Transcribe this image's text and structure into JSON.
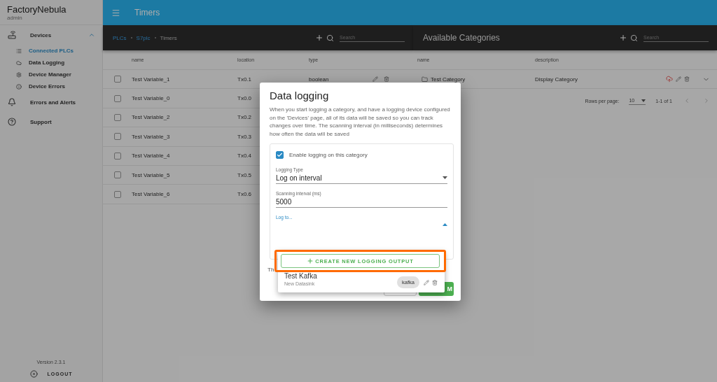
{
  "sidebar": {
    "brand": "FactoryNebula",
    "user": "admin",
    "items": [
      {
        "kind": "group",
        "label": "Devices",
        "expanded": true,
        "children": [
          {
            "label": "Connected PLCs",
            "selected": true
          },
          {
            "label": "Data Logging",
            "selected": false
          },
          {
            "label": "Device Manager",
            "selected": false
          },
          {
            "label": "Device Errors",
            "selected": false
          }
        ]
      },
      {
        "kind": "link",
        "label": "Errors and Alerts"
      },
      {
        "kind": "link",
        "label": "Support"
      }
    ],
    "version": "Version 2.3.1",
    "logout": "LOGOUT"
  },
  "top_bar": {
    "title": "Timers"
  },
  "variables_panel": {
    "breadcrumb": [
      "PLCs",
      "S7plc",
      "Timers"
    ],
    "search": {
      "placeholder": "Search"
    },
    "columns": [
      "name",
      "location",
      "type"
    ],
    "rows": [
      {
        "name": "Test Variable_1",
        "location": "Tx0.1",
        "type": "boolean",
        "checked": false
      },
      {
        "name": "Test Variable_0",
        "location": "Tx0.0",
        "checked": false
      },
      {
        "name": "Test Variable_2",
        "location": "Tx0.2",
        "checked": false
      },
      {
        "name": "Test Variable_3",
        "location": "Tx0.3",
        "checked": false
      },
      {
        "name": "Test Variable_4",
        "location": "Tx0.4",
        "checked": false
      },
      {
        "name": "Test Variable_5",
        "location": "Tx0.5",
        "checked": false
      },
      {
        "name": "Test Variable_6",
        "location": "Tx0.6",
        "checked": false
      }
    ]
  },
  "categories_panel": {
    "title": "Available Categories",
    "search": {
      "placeholder": "Search"
    },
    "columns": [
      "name",
      "description"
    ],
    "rows": [
      {
        "name": "Test Category",
        "description": "Display Category",
        "logging": true
      }
    ],
    "pagination": {
      "rows_per_page_label": "Rows per page:",
      "rows_per_page": "10",
      "range": "1-1 of 1"
    }
  },
  "dialog": {
    "title": "Data logging",
    "description": "When you start logging a category, and have a logging device configured on the 'Devices' page, all of its data will be saved so you can track changes over time. The scanning interval (in milliseconds) determines how often the data will be saved",
    "enable": {
      "label": "Enable logging on this category",
      "checked": true
    },
    "logging_type": {
      "label": "Logging Type",
      "value": "Log on interval"
    },
    "interval": {
      "label": "Scanning interval (ms)",
      "value": "5000"
    },
    "log_to": {
      "label": "Log to...",
      "expanded": true
    },
    "footer_text": "Th",
    "confirm": "M",
    "menu": {
      "create_button": "CREATE NEW LOGGING OUTPUT",
      "items": [
        {
          "name": "Test Kafka",
          "subtitle": "New Datasink",
          "tag": "kafka"
        }
      ]
    }
  }
}
